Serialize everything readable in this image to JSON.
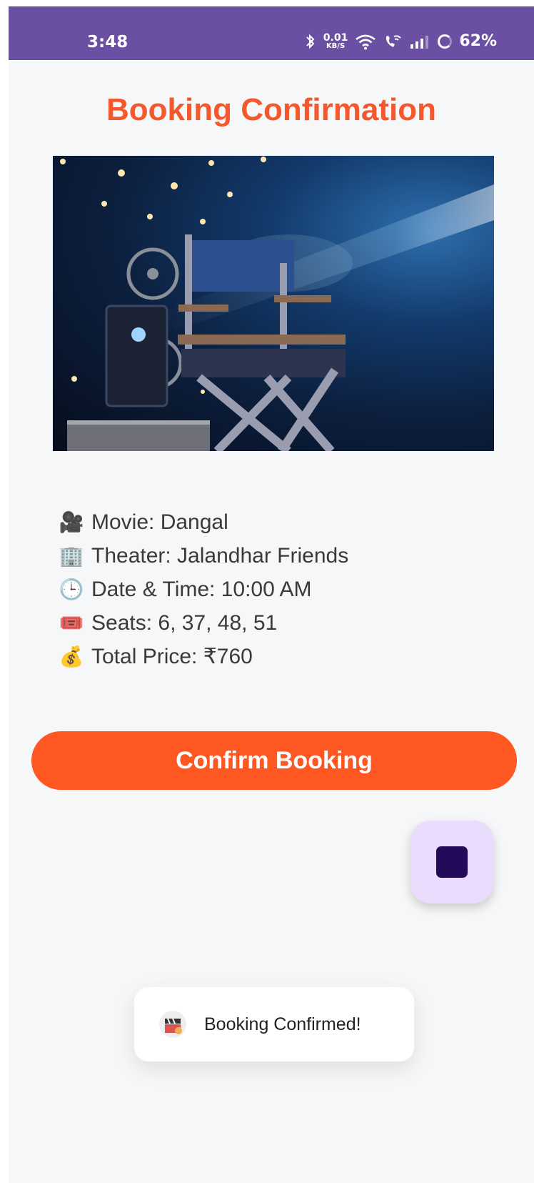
{
  "status_bar": {
    "time": "3:48",
    "net_speed_value": "0.01",
    "net_speed_unit": "KB/S",
    "battery": "62%"
  },
  "page": {
    "title": "Booking Confirmation"
  },
  "details": [
    {
      "icon": "movie-camera-icon",
      "emoji": "🎥",
      "text": "Movie: Dangal"
    },
    {
      "icon": "office-building-icon",
      "emoji": "🏢",
      "text": "Theater: Jalandhar Friends"
    },
    {
      "icon": "clock-icon",
      "emoji": "🕒",
      "text": "Date & Time: 10:00 AM"
    },
    {
      "icon": "ticket-icon",
      "emoji": "🎟️",
      "text": "Seats: 6, 37, 48, 51"
    },
    {
      "icon": "money-bag-icon",
      "emoji": "💰",
      "text": "Total Price: ₹760"
    }
  ],
  "actions": {
    "confirm_label": "Confirm Booking"
  },
  "toast": {
    "message": "Booking Confirmed!"
  },
  "colors": {
    "status_bar": "#6b4fa3",
    "accent": "#fe5722",
    "title": "#f4582c",
    "fab_bg": "#e9dcfc",
    "fab_icon": "#230a5a"
  }
}
